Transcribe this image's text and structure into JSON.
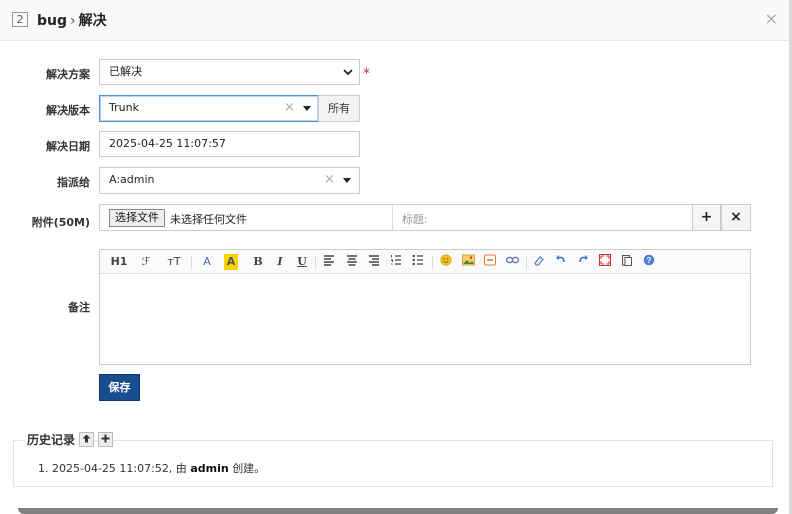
{
  "header": {
    "id_badge": "2",
    "module": "bug",
    "separator": "›",
    "action": "解决",
    "close": "×"
  },
  "form": {
    "resolution": {
      "label": "解决方案",
      "value": "已解决",
      "required_mark": "*"
    },
    "build": {
      "label": "解决版本",
      "value": "Trunk",
      "all_button": "所有"
    },
    "date": {
      "label": "解决日期",
      "value": "2025-04-25 11:07:57"
    },
    "assign": {
      "label": "指派给",
      "value": "A:admin"
    },
    "files": {
      "label": "附件(50M)",
      "choose_button": "选择文件",
      "no_file": "未选择任何文件",
      "title_placeholder": "标题:",
      "add": "+",
      "remove": "×"
    },
    "comment": {
      "label": "备注"
    },
    "save_button": "保存"
  },
  "editor_toolbar": {
    "heading": "H1",
    "font_family": "ℱ",
    "font_size": "тT",
    "font_color": "A",
    "bg_color": "A",
    "bold": "B",
    "italic": "I",
    "underline": "U"
  },
  "history": {
    "title": "历史记录",
    "items": [
      {
        "prefix": "1. 2025-04-25 11:07:52, 由",
        "user": "admin",
        "suffix": "创建。"
      }
    ]
  }
}
